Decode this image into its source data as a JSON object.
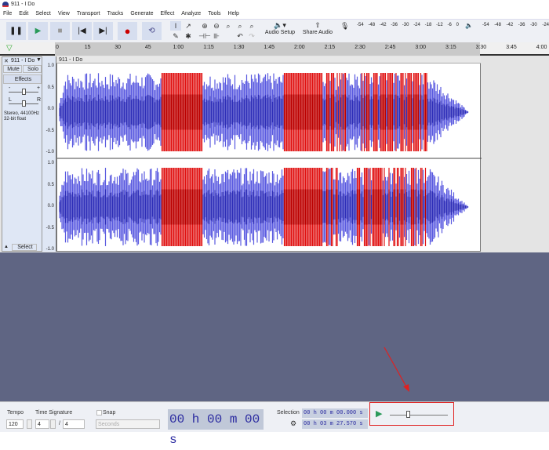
{
  "window": {
    "title": "911 - I Do"
  },
  "menu": [
    "File",
    "Edit",
    "Select",
    "View",
    "Transport",
    "Tracks",
    "Generate",
    "Effect",
    "Analyze",
    "Tools",
    "Help"
  ],
  "toolbar": {
    "audio_setup": "Audio Setup",
    "share_audio": "Share Audio",
    "meter_ticks": [
      "-54",
      "-48",
      "-42",
      "-36",
      "-30",
      "-24",
      "-18",
      "-12",
      "-6",
      "0"
    ],
    "play_meter_ticks": [
      "-54",
      "-48",
      "-42",
      "-36",
      "-30",
      "-24"
    ]
  },
  "ruler": {
    "ticks": [
      "0",
      "15",
      "30",
      "45",
      "1:00",
      "1:15",
      "1:30",
      "1:45",
      "2:00",
      "2:15",
      "2:30",
      "2:45",
      "3:00",
      "3:15",
      "3:30",
      "3:45",
      "4:00"
    ]
  },
  "track": {
    "name": "911 - I Do",
    "clip_name": "911 - I Do",
    "mute": "Mute",
    "solo": "Solo",
    "effects": "Effects",
    "gain_minus": "-",
    "gain_plus": "+",
    "pan_l": "L",
    "pan_r": "R",
    "info_line1": "Stereo, 44100Hz",
    "info_line2": "32-bit float",
    "select": "Select",
    "scale": [
      "1.0",
      "0.5",
      "0.0",
      "-0.5",
      "-1.0"
    ]
  },
  "bottom": {
    "tempo_label": "Tempo",
    "tempo": "120",
    "timesig_label": "Time Signature",
    "timesig_num": "4",
    "timesig_sep": "/",
    "timesig_den": "4",
    "snap_label": "Snap",
    "snap_unit": "Seconds",
    "time_display": "00 h 00 m 00 s",
    "selection_label": "Selection",
    "sel_start": "00 h 00 m 00.000 s",
    "sel_end": "00 h 03 m 27.570 s"
  },
  "colors": {
    "waveform": "#3d3dd0",
    "clipped": "#e01010",
    "highlight": "#e02020"
  }
}
